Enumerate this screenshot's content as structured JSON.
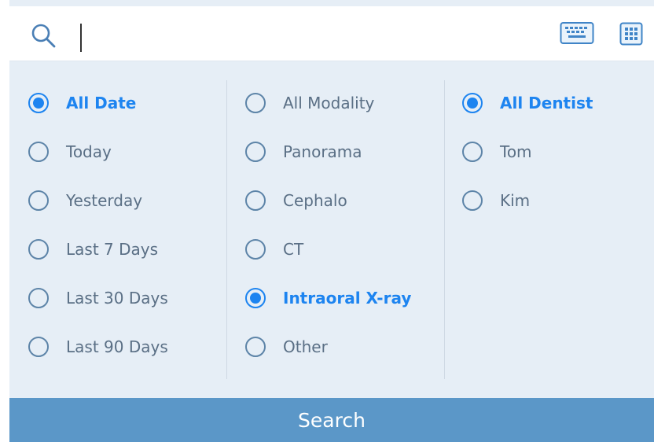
{
  "search": {
    "value": "",
    "placeholder": ""
  },
  "icons": {
    "search": "search-icon",
    "keyboard": "keyboard-icon",
    "grid": "grid-icon"
  },
  "filters": {
    "date": {
      "options": [
        "All Date",
        "Today",
        "Yesterday",
        "Last 7 Days",
        "Last 30 Days",
        "Last 90 Days"
      ],
      "selected": "All Date"
    },
    "modality": {
      "options": [
        "All Modality",
        "Panorama",
        "Cephalo",
        "CT",
        "Intraoral X-ray",
        "Other"
      ],
      "selected": "Intraoral X-ray"
    },
    "dentist": {
      "options": [
        "All Dentist",
        "Tom",
        "Kim"
      ],
      "selected": "All Dentist"
    }
  },
  "search_button": {
    "label": "Search"
  },
  "colors": {
    "accent": "#1d84f0",
    "panel": "#e6eef6",
    "button": "#5b97c8",
    "text": "#5a6f85"
  }
}
